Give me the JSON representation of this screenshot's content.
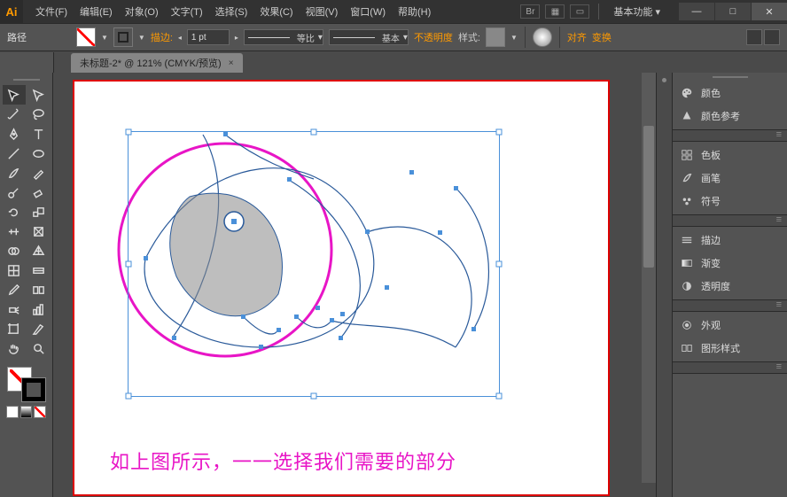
{
  "app_logo": "Ai",
  "menu": {
    "file": "文件(F)",
    "edit": "编辑(E)",
    "object": "对象(O)",
    "type": "文字(T)",
    "select": "选择(S)",
    "effect": "效果(C)",
    "view": "视图(V)",
    "window": "窗口(W)",
    "help": "帮助(H)"
  },
  "title_right": {
    "workspace": "基本功能"
  },
  "tool_label": "路径",
  "stroke": {
    "label": "描边:",
    "pt": "1 pt",
    "scale": "等比",
    "profile": "基本"
  },
  "opacity": {
    "label": "不透明度",
    "style": "样式:"
  },
  "align": {
    "align": "对齐",
    "transform": "变换"
  },
  "doc_tab": {
    "title": "未标题-2* @ 121% (CMYK/预览)",
    "close": "×"
  },
  "canvas": {
    "caption": "如上图所示，一一选择我们需要的部分"
  },
  "panels": {
    "group1": [
      {
        "id": "color",
        "label": "颜色"
      },
      {
        "id": "colorguide",
        "label": "颜色参考"
      }
    ],
    "group2": [
      {
        "id": "swatches",
        "label": "色板"
      },
      {
        "id": "brushes",
        "label": "画笔"
      },
      {
        "id": "symbols",
        "label": "符号"
      }
    ],
    "group3": [
      {
        "id": "stroke",
        "label": "描边"
      },
      {
        "id": "gradient",
        "label": "渐变"
      },
      {
        "id": "transparency",
        "label": "透明度"
      }
    ],
    "group4": [
      {
        "id": "appearance",
        "label": "外观"
      },
      {
        "id": "graphicstyles",
        "label": "图形样式"
      }
    ]
  }
}
